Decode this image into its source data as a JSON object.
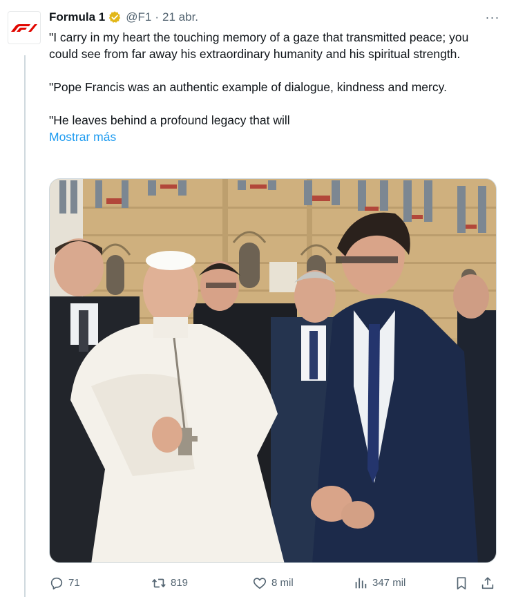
{
  "tweet": {
    "author_name": "Formula 1",
    "handle": "@F1",
    "separator": "·",
    "time": "21 abr.",
    "more_label": "···",
    "paragraphs": [
      "\"I carry in my heart the touching memory of a gaze that transmitted peace; you could see from far away his extraordinary humanity and his spiritual strength.",
      "\"Pope Francis was an authentic example of dialogue, kindness and mercy.",
      "\"He leaves behind a profound legacy that will"
    ],
    "show_more": "Mostrar más"
  },
  "actions": {
    "replies": "71",
    "reposts": "819",
    "likes": "8 mil",
    "views": "347 mil"
  },
  "colors": {
    "accent": "#1d9bf0",
    "verified": "#e2b719",
    "f1_red": "#e10600",
    "repost_green": "#00ba7c",
    "secondary_text": "#536471"
  },
  "icons": {
    "avatar": "f1-logo",
    "badge": "verified-gold-badge",
    "reply": "reply-icon",
    "repost": "repost-icon",
    "like": "heart-icon",
    "views": "views-icon",
    "bookmark": "bookmark-icon",
    "share": "share-icon"
  }
}
